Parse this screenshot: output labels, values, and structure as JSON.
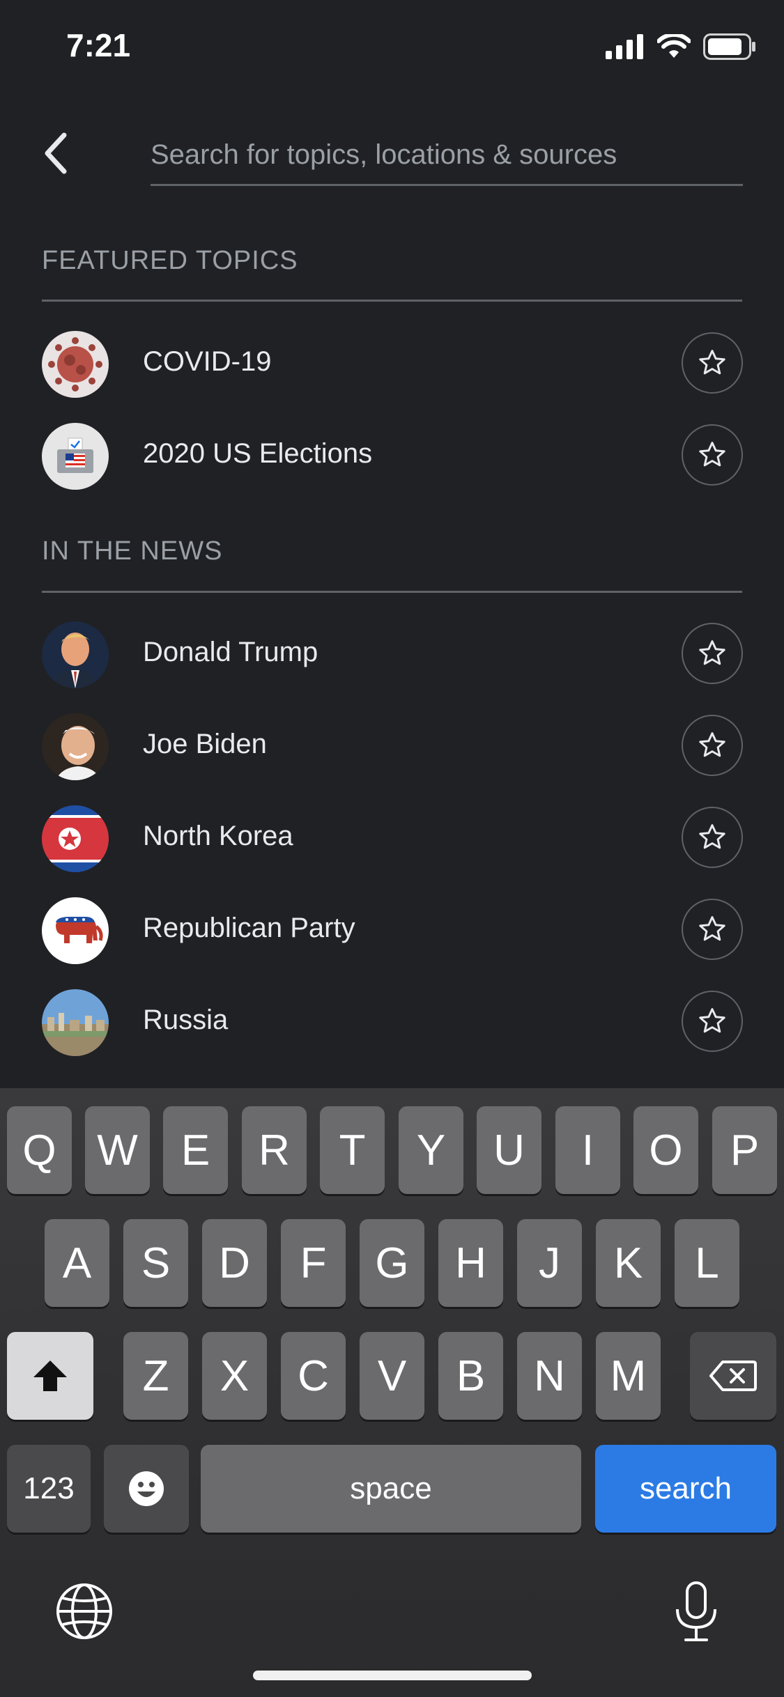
{
  "status": {
    "time": "7:21",
    "signal_icon": "cellular-signal-icon",
    "wifi_icon": "wifi-icon",
    "battery_icon": "battery-icon"
  },
  "header": {
    "search_placeholder": "Search for topics, locations & sources",
    "back_icon": "chevron-left-icon"
  },
  "sections": [
    {
      "title": "FEATURED TOPICS",
      "items": [
        {
          "label": "COVID-19",
          "avatar": "virus-image"
        },
        {
          "label": "2020 US Elections",
          "avatar": "ballot-box-image"
        }
      ]
    },
    {
      "title": "IN THE NEWS",
      "items": [
        {
          "label": "Donald Trump",
          "avatar": "person-photo"
        },
        {
          "label": "Joe Biden",
          "avatar": "person-photo"
        },
        {
          "label": "North Korea",
          "avatar": "flag-image"
        },
        {
          "label": "Republican Party",
          "avatar": "elephant-image"
        },
        {
          "label": "Russia",
          "avatar": "city-image"
        }
      ]
    }
  ],
  "keyboard": {
    "row1": [
      "Q",
      "W",
      "E",
      "R",
      "T",
      "Y",
      "U",
      "I",
      "O",
      "P"
    ],
    "row2": [
      "A",
      "S",
      "D",
      "F",
      "G",
      "H",
      "J",
      "K",
      "L"
    ],
    "row3": [
      "Z",
      "X",
      "C",
      "V",
      "B",
      "N",
      "M"
    ],
    "numbers_label": "123",
    "space_label": "space",
    "search_label": "search",
    "colors": {
      "accent": "#2c7be5",
      "key": "#6b6b6d",
      "background": "#202124"
    }
  }
}
